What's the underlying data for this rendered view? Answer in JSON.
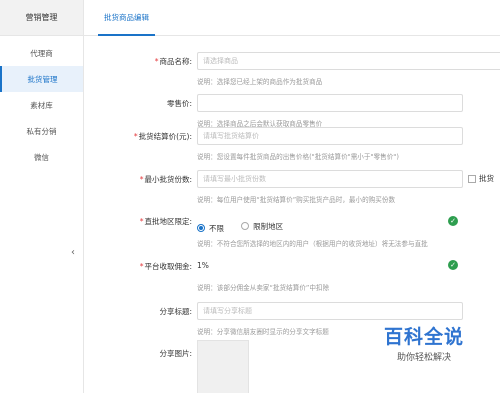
{
  "sidebar": {
    "header": "营销管理",
    "items": [
      {
        "label": "代理商"
      },
      {
        "label": "批货管理",
        "active": true
      },
      {
        "label": "素材库"
      },
      {
        "label": "私有分销"
      },
      {
        "label": "微信"
      }
    ],
    "collapse_icon": "chevron-left-icon"
  },
  "tabs": [
    {
      "label": "批货商品编辑"
    }
  ],
  "form": {
    "product_name": {
      "label": "商品名称:",
      "required": true,
      "placeholder": "请选择商品",
      "hint": "说明：选择您已经上架的商品作为批货商品"
    },
    "retail_price": {
      "label": "零售价:",
      "required": false,
      "value": "",
      "hint": "说明：选择商品之后会默认获取商品零售价"
    },
    "settle_price": {
      "label": "批货结算价(元):",
      "required": true,
      "placeholder": "请填写批货结算价",
      "hint": "说明：您设置每件批货商品的出售价格(\"批货结算价\"需小于\"零售价\")"
    },
    "min_qty": {
      "label": "最小批货份数:",
      "required": true,
      "placeholder": "请填写最小批货份数",
      "hint": "说明：每位用户使用“批货结算价”购买批货产品时，最小的购买份数",
      "side_checkbox_label": "批货"
    },
    "region": {
      "label": "直批地区限定:",
      "required": true,
      "options": [
        "不限",
        "限制地区"
      ],
      "selected": "不限",
      "hint": "说明：不符合您所选择的地区内的用户（根据用户的收货地址）将无法参与直批"
    },
    "commission": {
      "label": "平台收取佣金:",
      "required": true,
      "value": "1%",
      "hint": "说明：该部分佣金从卖家“批货结算价”中扣除"
    },
    "share_title": {
      "label": "分享标题:",
      "required": false,
      "placeholder": "请填写分享标题",
      "hint": "说明：分享微信朋友圈时显示的分享文字标题"
    },
    "share_image": {
      "label": "分享图片:",
      "required": false
    }
  },
  "watermark": {
    "title": "百科全说",
    "subtitle": "助你轻松解决"
  },
  "colors": {
    "accent": "#1a73c8",
    "required": "#e4393c",
    "success": "#2e9e4f"
  }
}
